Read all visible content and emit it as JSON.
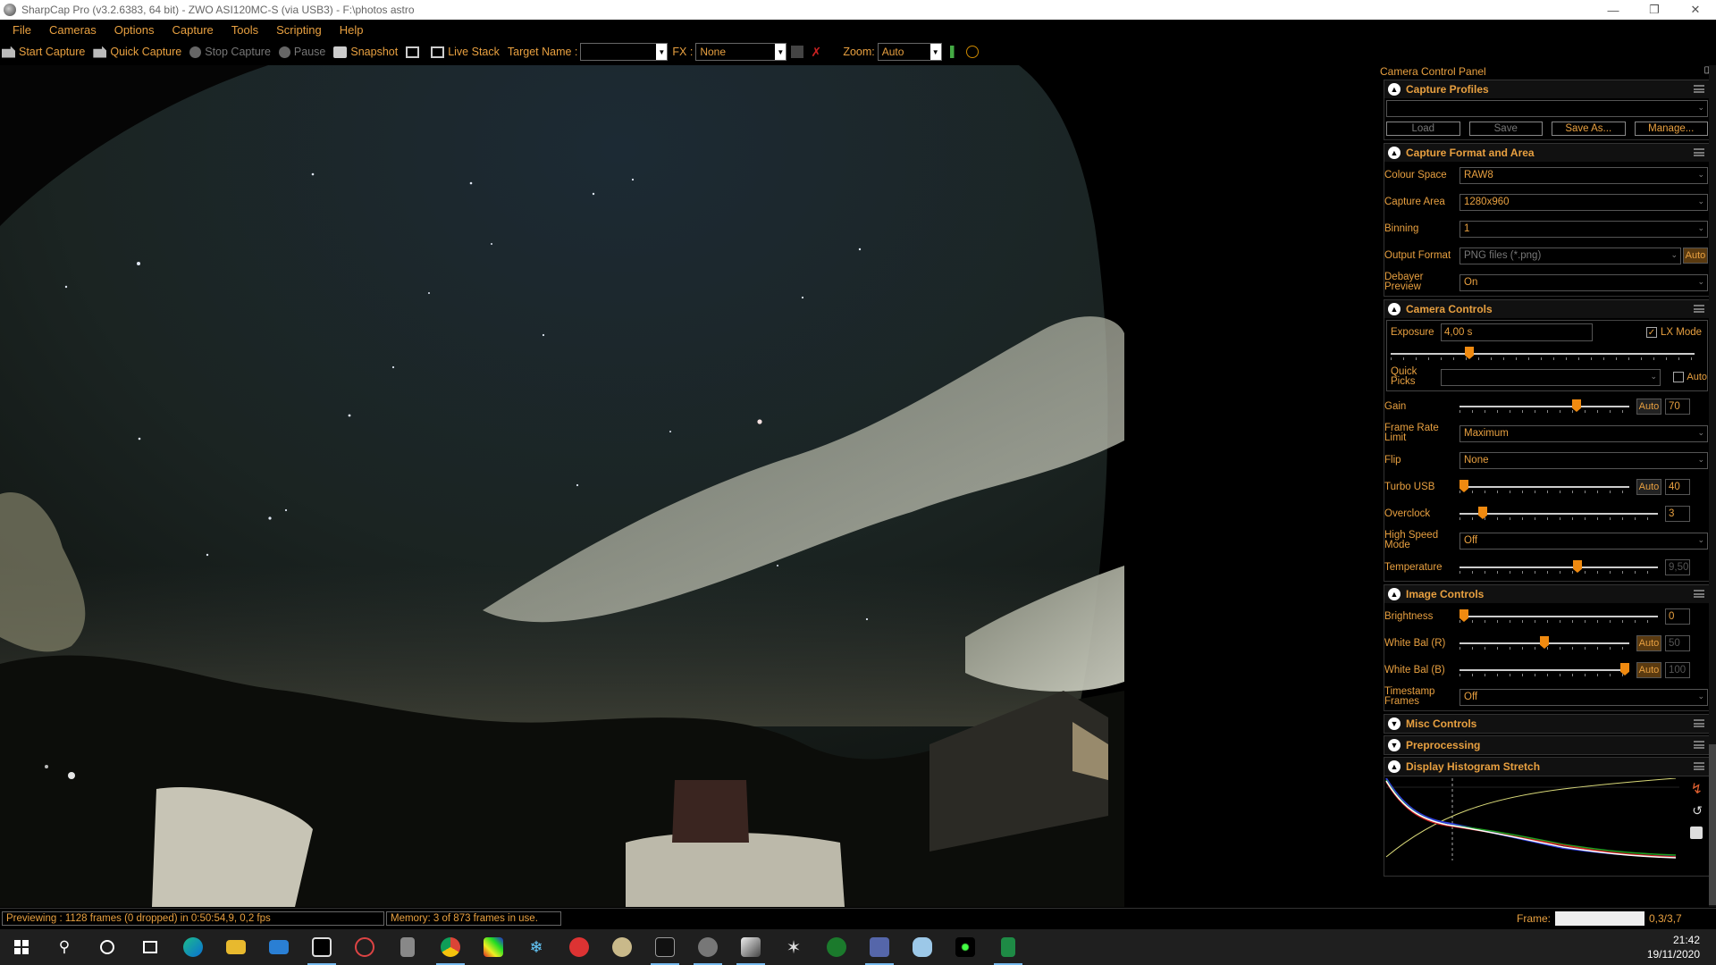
{
  "window": {
    "title": "SharpCap Pro (v3.2.6383, 64 bit) - ZWO ASI120MC-S (via USB3) - F:\\photos astro",
    "controls": [
      "minimize-icon",
      "restore-icon",
      "close-icon"
    ]
  },
  "menu": [
    "File",
    "Cameras",
    "Options",
    "Capture",
    "Tools",
    "Scripting",
    "Help"
  ],
  "toolbar": {
    "start_capture": "Start Capture",
    "quick_capture": "Quick Capture",
    "stop_capture": "Stop Capture",
    "pause": "Pause",
    "snapshot": "Snapshot",
    "live_stack": "Live Stack",
    "target_name_label": "Target Name :",
    "target_name_value": "",
    "fx_label": "FX :",
    "fx_value": "None",
    "zoom_label": "Zoom:",
    "zoom_value": "Auto"
  },
  "panel": {
    "title": "Camera Control Panel",
    "capture_profiles": {
      "header": "Capture Profiles",
      "profile_value": "",
      "buttons": [
        "Load",
        "Save",
        "Save As...",
        "Manage..."
      ]
    },
    "capture_format": {
      "header": "Capture Format and Area",
      "colour_space_label": "Colour Space",
      "colour_space": "RAW8",
      "capture_area_label": "Capture Area",
      "capture_area": "1280x960",
      "binning_label": "Binning",
      "binning": "1",
      "output_format_label": "Output Format",
      "output_format": "PNG files (*.png)",
      "output_auto": "Auto",
      "debayer_label": "Debayer Preview",
      "debayer": "On"
    },
    "camera_controls": {
      "header": "Camera Controls",
      "exposure_label": "Exposure",
      "exposure": "4,00 s",
      "lx_mode_label": "LX Mode",
      "lx_mode": true,
      "exposure_slider": 0.25,
      "quick_picks_label": "Quick Picks",
      "quick_picks": "",
      "quick_auto": "Auto",
      "gain_label": "Gain",
      "gain_auto": "Auto",
      "gain": "70",
      "gain_level": 0.7,
      "frame_rate_label": "Frame Rate Limit",
      "frame_rate": "Maximum",
      "flip_label": "Flip",
      "flip": "None",
      "turbo_label": "Turbo USB",
      "turbo_auto": "Auto",
      "turbo": "40",
      "turbo_level": 0.0,
      "overclock_label": "Overclock",
      "overclock": "3",
      "overclock_level": 0.1,
      "high_speed_label": "High Speed Mode",
      "high_speed": "Off",
      "temperature_label": "Temperature",
      "temperature": "9,50",
      "temperature_level": 0.6
    },
    "image_controls": {
      "header": "Image Controls",
      "brightness_label": "Brightness",
      "brightness": "0",
      "brightness_level": 0.0,
      "wb_r_label": "White Bal (R)",
      "wb_r_auto": "Auto",
      "wb_r": "50",
      "wb_r_level": 0.5,
      "wb_b_label": "White Bal (B)",
      "wb_b_auto": "Auto",
      "wb_b": "100",
      "wb_b_level": 1.0,
      "timestamp_label": "Timestamp Frames",
      "timestamp": "Off"
    },
    "misc": {
      "header": "Misc Controls"
    },
    "preprocessing": {
      "header": "Preprocessing"
    },
    "histogram": {
      "header": "Display Histogram Stretch"
    }
  },
  "status": {
    "preview": "Previewing : 1128 frames (0 dropped) in 0:50:54,9, 0,2 fps",
    "memory": "Memory: 3 of 873 frames in use.",
    "frame_label": "Frame:",
    "frame_value": "0,3/3,7"
  },
  "taskbar": {
    "icons": [
      "windows-start-icon",
      "search-icon",
      "cortana-icon",
      "task-view-icon",
      "edge-icon",
      "file-explorer-icon",
      "mail-icon",
      "sharpcap-icon",
      "paint-icon",
      "calculator-icon",
      "chrome-icon",
      "color-app-icon",
      "snowflake-icon",
      "astro-app-icon",
      "paint-palette-icon",
      "camera-app-icon",
      "globe-app-icon",
      "photo-app-icon",
      "star-app-icon",
      "defender-icon",
      "image-app-icon",
      "cloud-app-icon",
      "green-dot-app-icon",
      "spreadsheet-icon"
    ],
    "time": "21:42",
    "date": "19/11/2020"
  }
}
